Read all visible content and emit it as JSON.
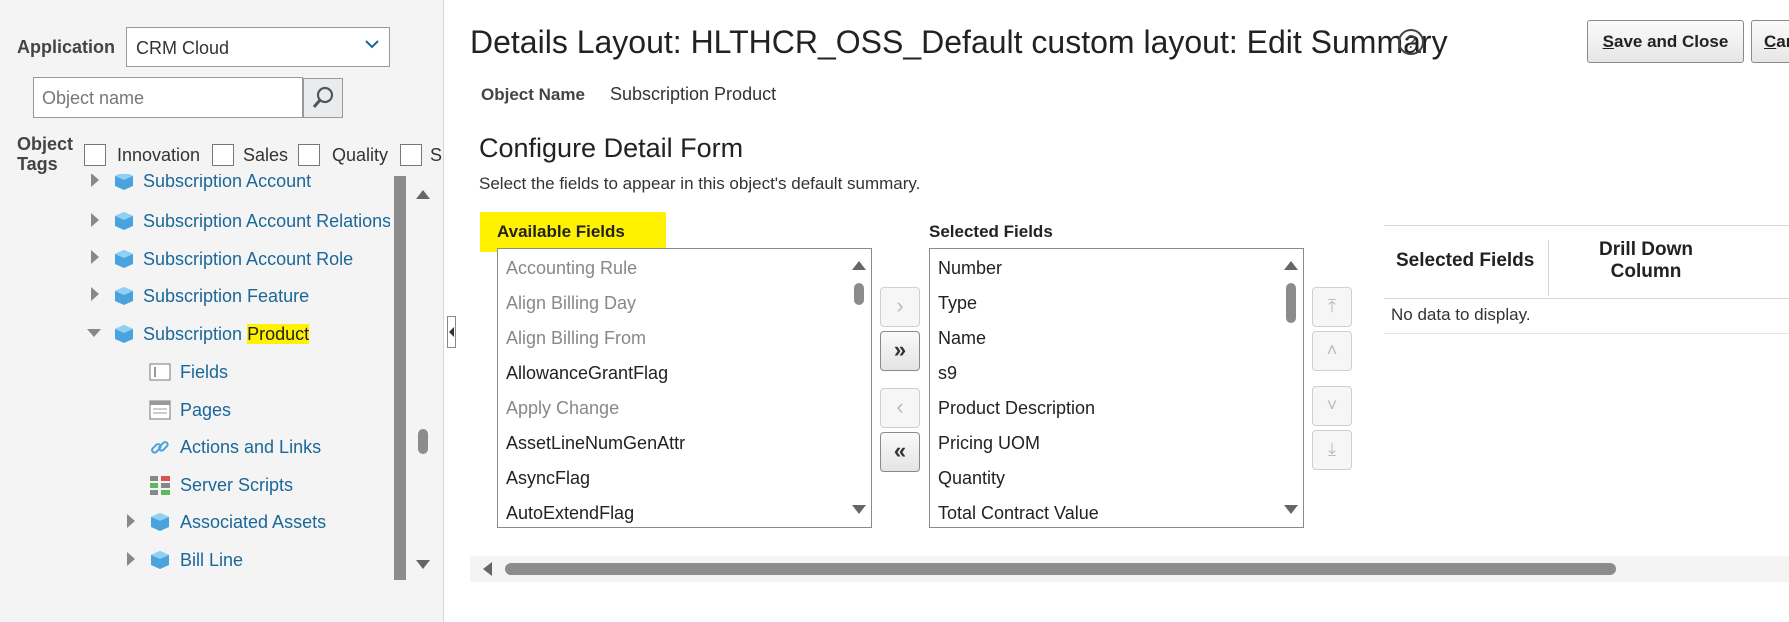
{
  "app": {
    "application_label": "Application",
    "application_value": "CRM Cloud",
    "object_name_placeholder": "Object name",
    "object_tags_label_1": "Object",
    "object_tags_label_2": "Tags",
    "tags": [
      "Innovation",
      "Sales",
      "Quality",
      "S"
    ]
  },
  "tree": {
    "items": [
      {
        "label": "Subscription Account"
      },
      {
        "label": "Subscription Account Relations"
      },
      {
        "label": "Subscription Account Role"
      },
      {
        "label": "Subscription Feature"
      },
      {
        "label_pre": "Subscription ",
        "label_hl": "Product"
      },
      {
        "label": "Fields"
      },
      {
        "label": "Pages"
      },
      {
        "label": "Actions and Links"
      },
      {
        "label": "Server Scripts"
      },
      {
        "label": "Associated Assets"
      },
      {
        "label": "Bill Line"
      }
    ]
  },
  "header": {
    "title": "Details Layout: HLTHCR_OSS_Default custom layout: Edit Summary",
    "help_symbol": "?",
    "save_close_label_s": "S",
    "save_close_label_rest": "ave and Close",
    "cancel_label_c": "C",
    "cancel_label_rest": "an"
  },
  "object": {
    "name_label": "Object Name",
    "name_value": "Subscription Product"
  },
  "form": {
    "heading": "Configure Detail Form",
    "description": "Select the fields to appear in this object's default summary.",
    "available_label": "Available Fields",
    "selected_label": "Selected Fields",
    "available_fields": [
      {
        "label": "Accounting Rule",
        "enabled": false
      },
      {
        "label": "Align Billing Day",
        "enabled": false
      },
      {
        "label": "Align Billing From",
        "enabled": false
      },
      {
        "label": "AllowanceGrantFlag",
        "enabled": true
      },
      {
        "label": "Apply Change",
        "enabled": false
      },
      {
        "label": "AssetLineNumGenAttr",
        "enabled": true
      },
      {
        "label": "AsyncFlag",
        "enabled": true
      },
      {
        "label": "AutoExtendFlag",
        "enabled": true
      }
    ],
    "selected_fields": [
      "Number",
      "Type",
      "Name",
      "s9",
      "Product Description",
      "Pricing UOM",
      "Quantity",
      "Total Contract Value"
    ]
  },
  "table": {
    "col1": "Selected Fields",
    "col2_line1": "Drill Down",
    "col2_line2": "Column",
    "empty": "No data to display."
  },
  "colors": {
    "highlight": "#fff200",
    "link": "#1b6799"
  }
}
